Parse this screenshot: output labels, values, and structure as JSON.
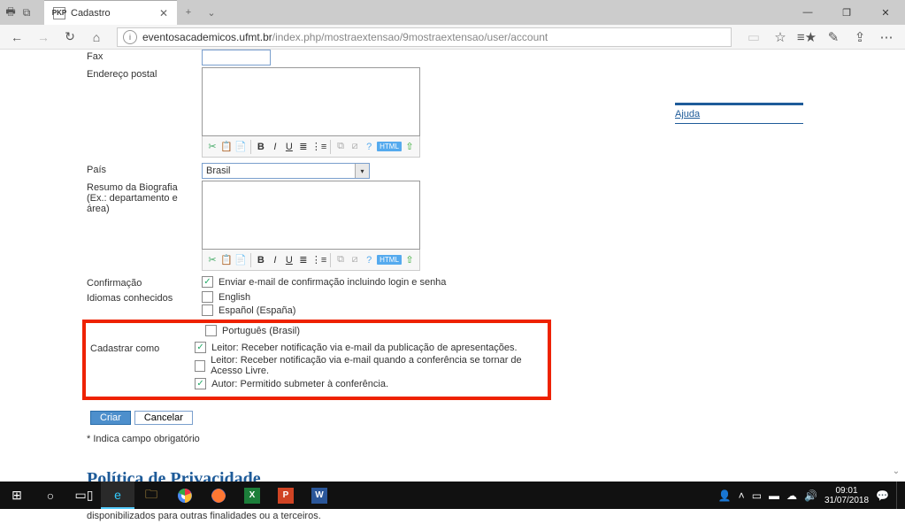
{
  "window": {
    "tab_title": "Cadastro",
    "tab_prefix": "PKP"
  },
  "url": {
    "host": "eventosacademicos.ufmt.br",
    "path": "/index.php/mostraextensao/9mostraextensao/user/account"
  },
  "labels": {
    "fax": "Fax",
    "endereco": "Endereço postal",
    "pais": "País",
    "bio": "Resumo da Biografia",
    "bio2": "(Ex.: departamento e área)",
    "confirmacao": "Confirmação",
    "idiomas": "Idiomas conhecidos",
    "cadastrar": "Cadastrar como"
  },
  "country": {
    "selected": "Brasil"
  },
  "checkboxes": {
    "confirm_label": "Enviar e-mail de confirmação incluindo login e senha",
    "lang_en": "English",
    "lang_es": "Español (España)",
    "lang_pt": "Português (Brasil)",
    "role_reader": "Leitor: Receber notificação via e-mail da publicação de apresentações.",
    "role_reader2": "Leitor: Receber notificação via e-mail quando a conferência se tornar de Acesso Livre.",
    "role_author": "Autor: Permitido submeter à conferência."
  },
  "buttons": {
    "create": "Criar",
    "cancel": "Cancelar"
  },
  "notes": {
    "required": "* Indica campo obrigatório"
  },
  "policy": {
    "title": "Política de Privacidade",
    "text": "Os nomes e endereços informados nesta conferência serão usados exclusivamente para os serviços prestados por este evento, não sendo disponibilizados para outras finalidades ou a terceiros."
  },
  "sidebar": {
    "help": "Ajuda"
  },
  "clock": {
    "time": "09:01",
    "date": "31/07/2018"
  },
  "toolbar_icons": {
    "cut": "✂",
    "copy": "📋",
    "paste": "📄",
    "bold": "B",
    "italic": "I",
    "underline": "U",
    "list_ul": "≣",
    "list_ol": "⋮≡",
    "html": "HTML"
  }
}
